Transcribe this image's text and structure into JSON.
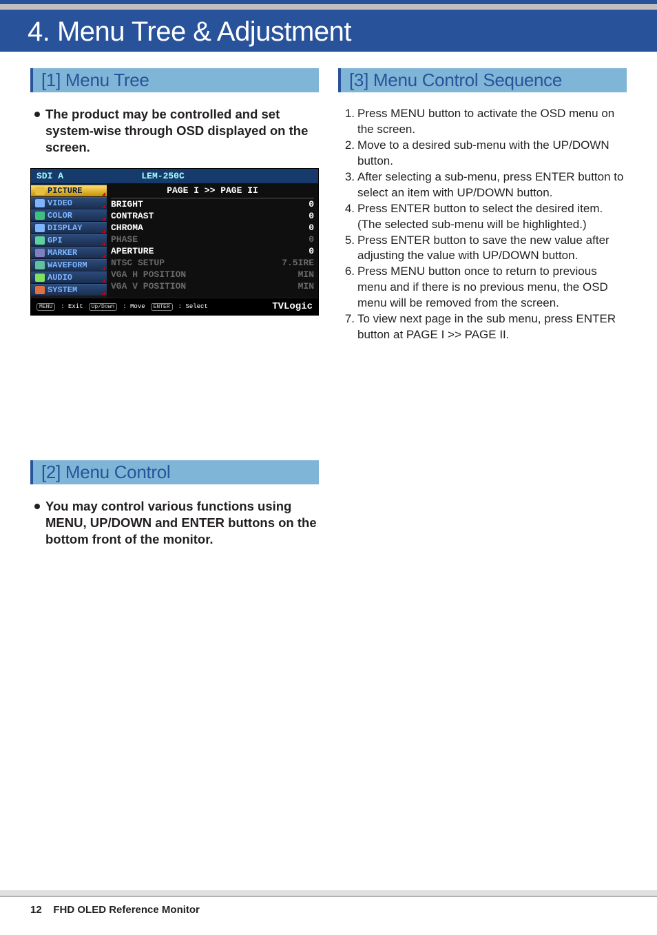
{
  "chapter": {
    "title": "4. Menu Tree & Adjustment"
  },
  "sections": {
    "menu_tree": {
      "heading": "[1] Menu Tree",
      "lead": "The product may be controlled and set system-wise through OSD displayed on the screen."
    },
    "menu_control": {
      "heading": "[2] Menu Control",
      "lead": "You may control various functions using MENU, UP/DOWN and ENTER buttons on the bottom front of the monitor."
    },
    "menu_control_sequence": {
      "heading": "[3] Menu Control Sequence",
      "steps": [
        "Press MENU button to activate the OSD menu on the screen.",
        "Move to a desired sub-menu with the UP/DOWN button.",
        "After selecting a sub-menu, press ENTER button to select an item with UP/DOWN button.",
        "Press ENTER button to select the desired item.",
        "Press ENTER button to save the new value after adjusting the value with UP/DOWN button.",
        "Press MENU button once to return to previous menu and if there is no previous menu, the OSD menu will be removed from the screen.",
        "To view next page in the sub menu, press ENTER button at PAGE I >> PAGE II."
      ],
      "step4_note": "(The selected sub-menu will be highlighted.)"
    }
  },
  "osd": {
    "title_left": "SDI A",
    "title_right": "LEM-250C",
    "nav": [
      "PICTURE",
      "VIDEO",
      "COLOR",
      "DISPLAY",
      "GPI",
      "MARKER",
      "WAVEFORM",
      "AUDIO",
      "SYSTEM"
    ],
    "nav_selected_index": 0,
    "page_header": "PAGE I >> PAGE II",
    "rows": [
      {
        "label": "BRIGHT",
        "value": "0",
        "dim": false
      },
      {
        "label": "CONTRAST",
        "value": "0",
        "dim": false
      },
      {
        "label": "CHROMA",
        "value": "0",
        "dim": false
      },
      {
        "label": "PHASE",
        "value": "0",
        "dim": true
      },
      {
        "label": "APERTURE",
        "value": "0",
        "dim": false
      },
      {
        "label": "NTSC SETUP",
        "value": "7.5IRE",
        "dim": true
      },
      {
        "label": "VGA H POSITION",
        "value": "MIN",
        "dim": true
      },
      {
        "label": "VGA V POSITION",
        "value": "MIN",
        "dim": true
      }
    ],
    "footer_keys": [
      {
        "key": "MENU",
        "action": ": Exit"
      },
      {
        "key": "Up/Down",
        "action": ": Move"
      },
      {
        "key": "ENTER",
        "action": ": Select"
      }
    ],
    "brand": "TVLogic"
  },
  "footer": {
    "page_number": "12",
    "doc_title": "FHD OLED Reference Monitor"
  }
}
